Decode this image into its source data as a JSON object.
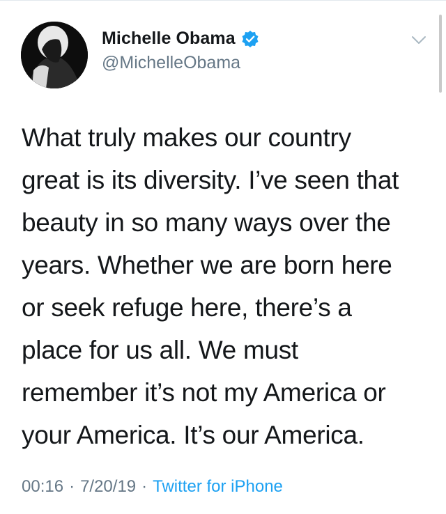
{
  "tweet": {
    "display_name": "Michelle Obama",
    "handle": "@MichelleObama",
    "verified": true,
    "text": "What truly makes our country\ngreat is its diversity. I’ve seen that\nbeauty in so many ways over the\nyears. Whether we are born here\nor seek refuge here, there’s a\nplace for us all. We must\nremember it’s not my America or\nyour America. It’s our America.",
    "time": "00:16",
    "date": "7/20/19",
    "separator": "·",
    "source": "Twitter for iPhone"
  },
  "icons": {
    "verified": "verified-badge-icon",
    "menu": "chevron-down-icon"
  },
  "colors": {
    "accent": "#1da1f2",
    "text": "#14171a",
    "secondary": "#657786"
  }
}
